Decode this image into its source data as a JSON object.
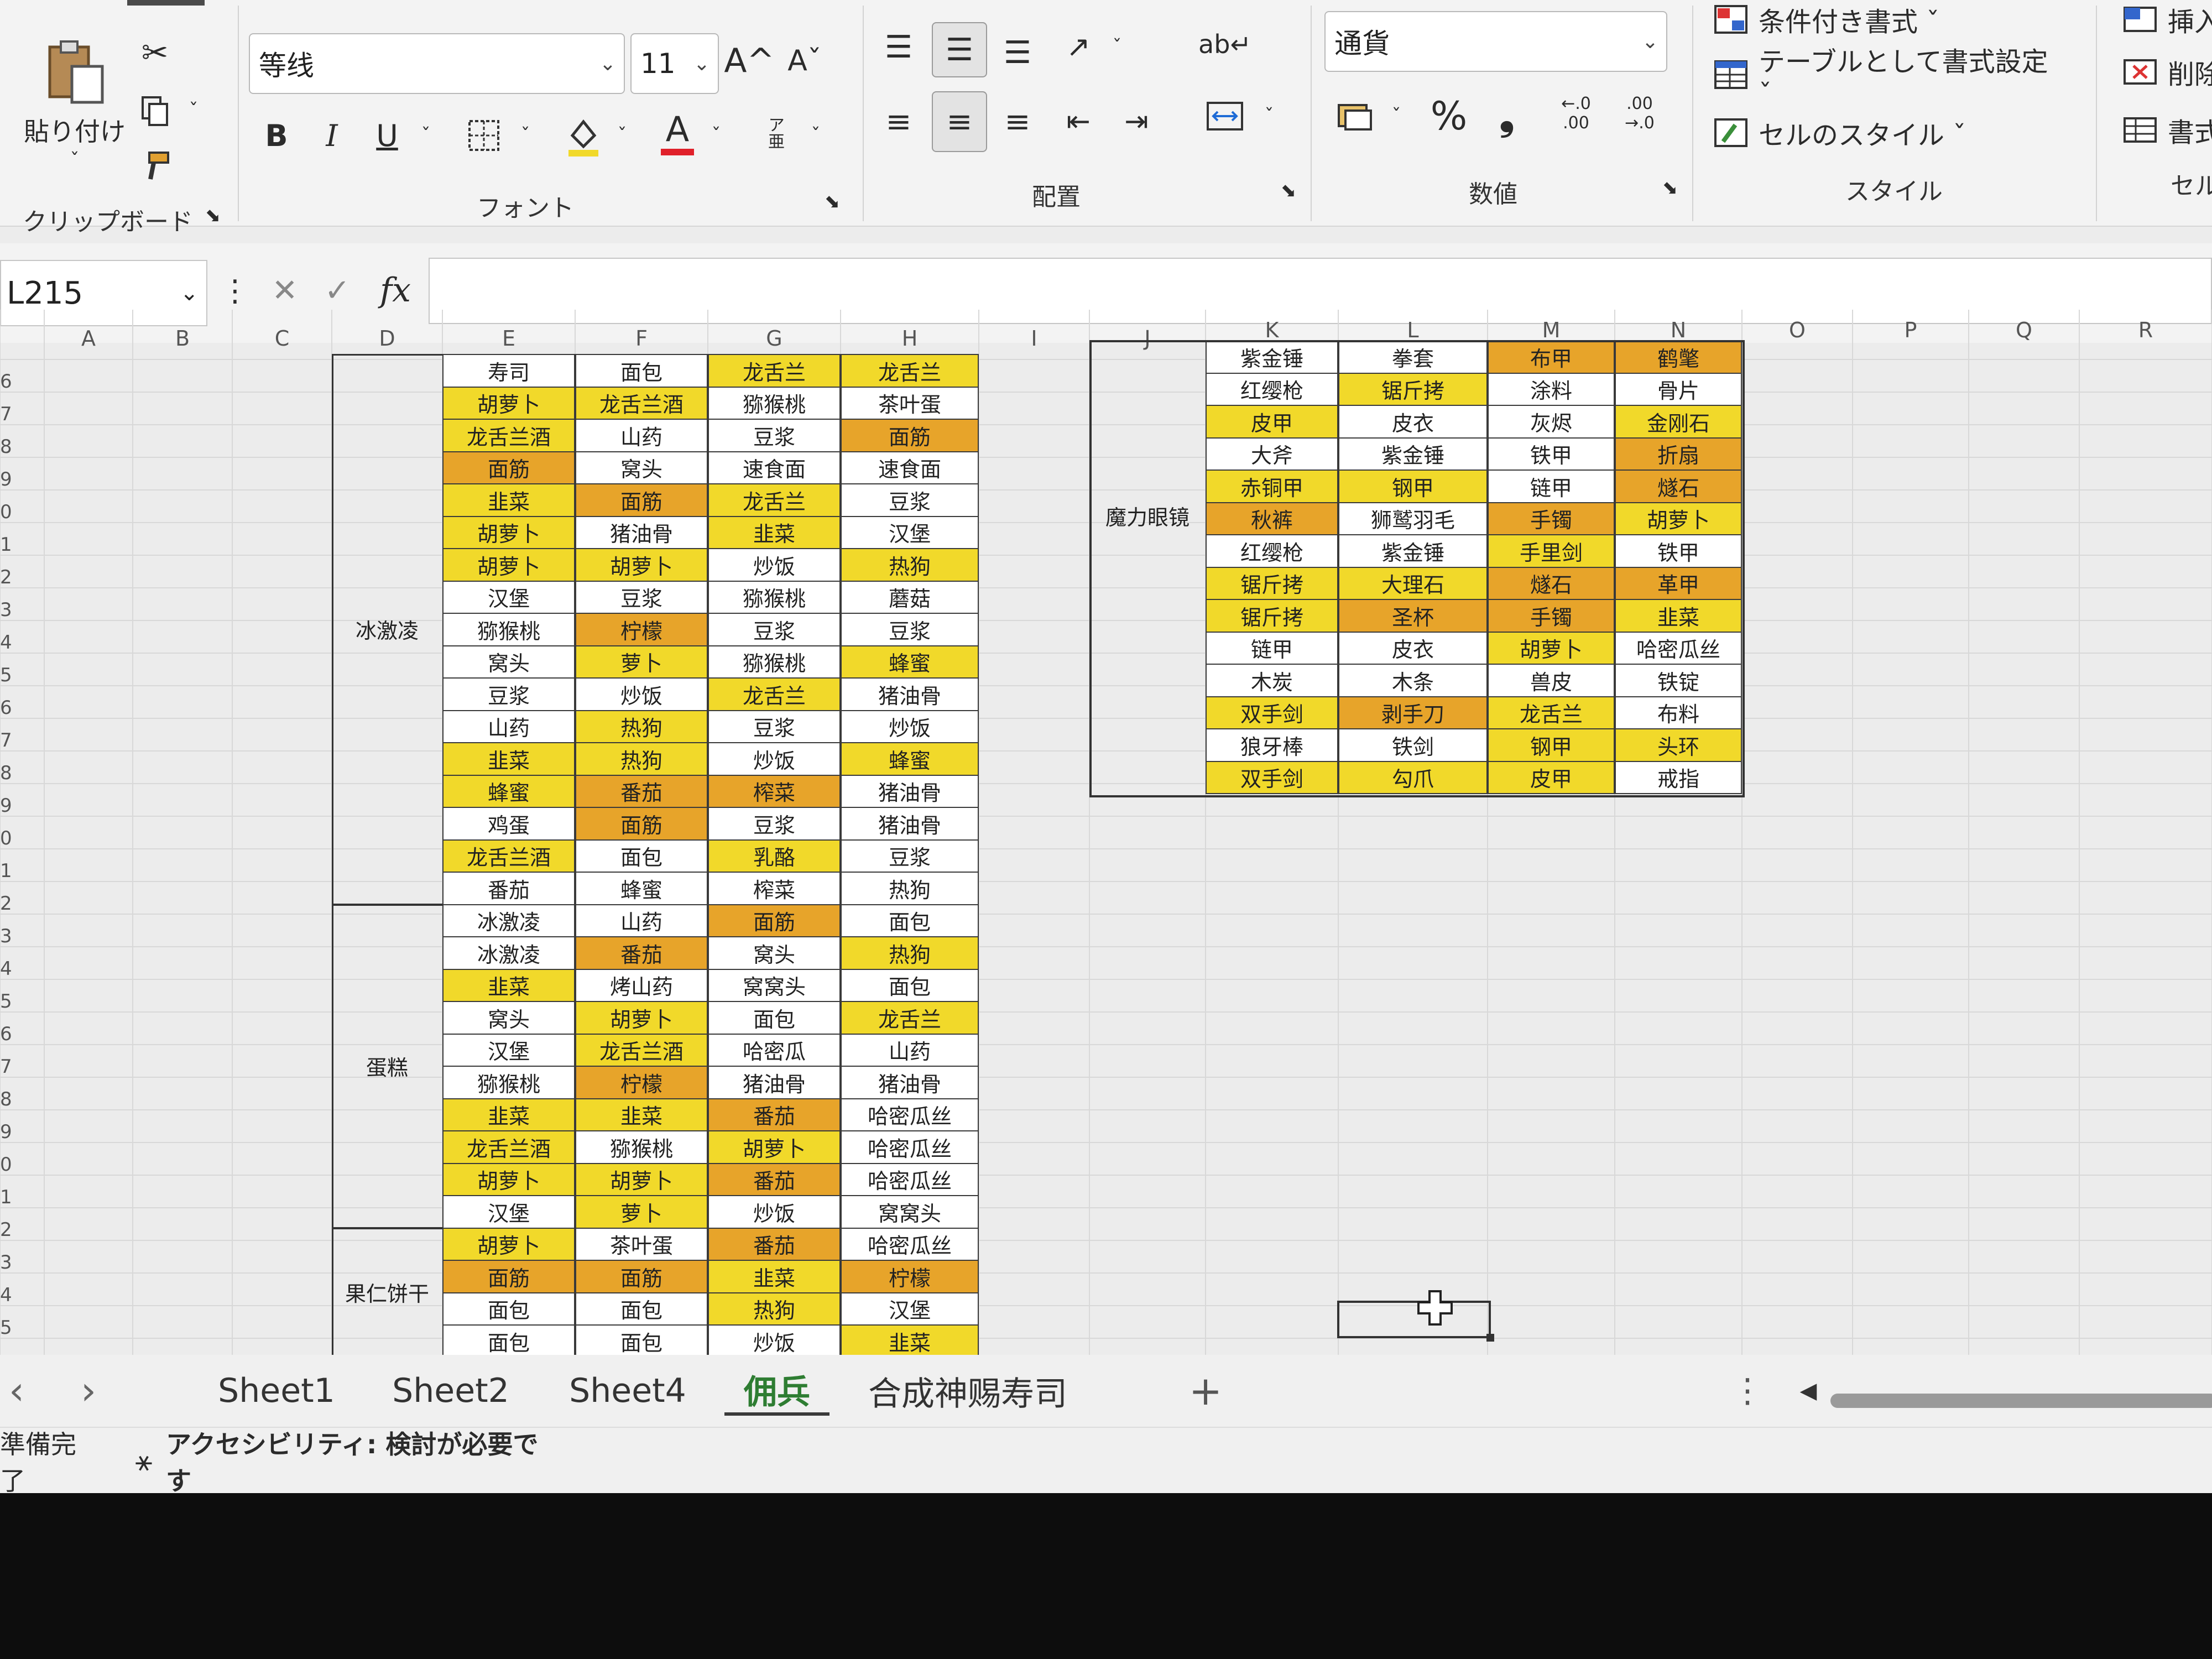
{
  "ribbon": {
    "clipboard": {
      "paste_label": "貼り付け",
      "group_label": "クリップボード"
    },
    "font": {
      "font_name": "等线",
      "font_size": "11",
      "group_label": "フォント",
      "bold": "B",
      "italic": "I",
      "underline": "U",
      "grow": "A^",
      "shrink": "Aˇ",
      "color_a": "A",
      "phonetic": "ア亜"
    },
    "alignment": {
      "group_label": "配置"
    },
    "number": {
      "format": "通貨",
      "percent": "%",
      "comma": "❟",
      "group_label": "数値",
      "inc_dec": "←.0 .00",
      "dec_dec": ".00 →.0"
    },
    "styles": {
      "conditional": "条件付き書式 ˇ",
      "table": "テーブルとして書式設定 ˇ",
      "cell_styles": "セルのスタイル ˇ",
      "group_label": "スタイル"
    },
    "cells": {
      "insert": "挿入",
      "delete": "削除",
      "format": "書式",
      "group_label": "セル"
    }
  },
  "formula_bar": {
    "name_box": "L215",
    "fx": "fx",
    "cancel": "✕",
    "enter": "✓"
  },
  "columns": [
    "A",
    "B",
    "C",
    "D",
    "E",
    "F",
    "G",
    "H",
    "I",
    "J",
    "K",
    "L",
    "M",
    "N",
    "O",
    "P",
    "Q",
    "R"
  ],
  "row_numbers": [
    "6",
    "7",
    "8",
    "9",
    "0",
    "1",
    "2",
    "3",
    "4",
    "5",
    "6",
    "7",
    "8",
    "9",
    "0",
    "1",
    "2",
    "3",
    "4",
    "5",
    "6",
    "7",
    "8",
    "9",
    "0",
    "1",
    "2",
    "3",
    "4",
    "5"
  ],
  "colors": {
    "yellow": "#f1d92a",
    "orange": "#e7a42a",
    "white": "#ffffff",
    "grid": "#d8d8d8"
  },
  "left_groups": [
    {
      "label": "冰激凌"
    },
    {
      "label": "蛋糕"
    },
    {
      "label": "果仁饼干"
    }
  ],
  "left_table": [
    [
      [
        "寿司",
        "w"
      ],
      [
        "面包",
        "w"
      ],
      [
        "龙舌兰",
        "y"
      ],
      [
        "龙舌兰",
        "y"
      ]
    ],
    [
      [
        "胡萝卜",
        "y"
      ],
      [
        "龙舌兰酒",
        "y"
      ],
      [
        "猕猴桃",
        "w"
      ],
      [
        "茶叶蛋",
        "w"
      ]
    ],
    [
      [
        "龙舌兰酒",
        "y"
      ],
      [
        "山药",
        "w"
      ],
      [
        "豆浆",
        "w"
      ],
      [
        "面筋",
        "o"
      ]
    ],
    [
      [
        "面筋",
        "o"
      ],
      [
        "窝头",
        "w"
      ],
      [
        "速食面",
        "w"
      ],
      [
        "速食面",
        "w"
      ]
    ],
    [
      [
        "韭菜",
        "y"
      ],
      [
        "面筋",
        "o"
      ],
      [
        "龙舌兰",
        "y"
      ],
      [
        "豆浆",
        "w"
      ]
    ],
    [
      [
        "胡萝卜",
        "y"
      ],
      [
        "猪油骨",
        "w"
      ],
      [
        "韭菜",
        "y"
      ],
      [
        "汉堡",
        "w"
      ]
    ],
    [
      [
        "胡萝卜",
        "y"
      ],
      [
        "胡萝卜",
        "y"
      ],
      [
        "炒饭",
        "w"
      ],
      [
        "热狗",
        "y"
      ]
    ],
    [
      [
        "汉堡",
        "w"
      ],
      [
        "豆浆",
        "w"
      ],
      [
        "猕猴桃",
        "w"
      ],
      [
        "蘑菇",
        "w"
      ]
    ],
    [
      [
        "猕猴桃",
        "w"
      ],
      [
        "柠檬",
        "o"
      ],
      [
        "豆浆",
        "w"
      ],
      [
        "豆浆",
        "w"
      ]
    ],
    [
      [
        "窝头",
        "w"
      ],
      [
        "萝卜",
        "y"
      ],
      [
        "猕猴桃",
        "w"
      ],
      [
        "蜂蜜",
        "y"
      ]
    ],
    [
      [
        "豆浆",
        "w"
      ],
      [
        "炒饭",
        "w"
      ],
      [
        "龙舌兰",
        "y"
      ],
      [
        "猪油骨",
        "w"
      ]
    ],
    [
      [
        "山药",
        "w"
      ],
      [
        "热狗",
        "y"
      ],
      [
        "豆浆",
        "w"
      ],
      [
        "炒饭",
        "w"
      ]
    ],
    [
      [
        "韭菜",
        "y"
      ],
      [
        "热狗",
        "y"
      ],
      [
        "炒饭",
        "w"
      ],
      [
        "蜂蜜",
        "y"
      ]
    ],
    [
      [
        "蜂蜜",
        "y"
      ],
      [
        "番茄",
        "o"
      ],
      [
        "榨菜",
        "o"
      ],
      [
        "猪油骨",
        "w"
      ]
    ],
    [
      [
        "鸡蛋",
        "w"
      ],
      [
        "面筋",
        "o"
      ],
      [
        "豆浆",
        "w"
      ],
      [
        "猪油骨",
        "w"
      ]
    ],
    [
      [
        "龙舌兰酒",
        "y"
      ],
      [
        "面包",
        "w"
      ],
      [
        "乳酪",
        "y"
      ],
      [
        "豆浆",
        "w"
      ]
    ],
    [
      [
        "番茄",
        "w"
      ],
      [
        "蜂蜜",
        "w"
      ],
      [
        "榨菜",
        "w"
      ],
      [
        "热狗",
        "w"
      ]
    ],
    [
      [
        "冰激凌",
        "w"
      ],
      [
        "山药",
        "w"
      ],
      [
        "面筋",
        "o"
      ],
      [
        "面包",
        "w"
      ]
    ],
    [
      [
        "冰激凌",
        "w"
      ],
      [
        "番茄",
        "o"
      ],
      [
        "窝头",
        "w"
      ],
      [
        "热狗",
        "y"
      ]
    ],
    [
      [
        "韭菜",
        "y"
      ],
      [
        "烤山药",
        "w"
      ],
      [
        "窝窝头",
        "w"
      ],
      [
        "面包",
        "w"
      ]
    ],
    [
      [
        "窝头",
        "w"
      ],
      [
        "胡萝卜",
        "y"
      ],
      [
        "面包",
        "w"
      ],
      [
        "龙舌兰",
        "y"
      ]
    ],
    [
      [
        "汉堡",
        "w"
      ],
      [
        "龙舌兰酒",
        "y"
      ],
      [
        "哈密瓜",
        "w"
      ],
      [
        "山药",
        "w"
      ]
    ],
    [
      [
        "猕猴桃",
        "w"
      ],
      [
        "柠檬",
        "o"
      ],
      [
        "猪油骨",
        "w"
      ],
      [
        "猪油骨",
        "w"
      ]
    ],
    [
      [
        "韭菜",
        "y"
      ],
      [
        "韭菜",
        "y"
      ],
      [
        "番茄",
        "o"
      ],
      [
        "哈密瓜丝",
        "w"
      ]
    ],
    [
      [
        "龙舌兰酒",
        "y"
      ],
      [
        "猕猴桃",
        "w"
      ],
      [
        "胡萝卜",
        "y"
      ],
      [
        "哈密瓜丝",
        "w"
      ]
    ],
    [
      [
        "胡萝卜",
        "y"
      ],
      [
        "胡萝卜",
        "y"
      ],
      [
        "番茄",
        "o"
      ],
      [
        "哈密瓜丝",
        "w"
      ]
    ],
    [
      [
        "汉堡",
        "w"
      ],
      [
        "萝卜",
        "y"
      ],
      [
        "炒饭",
        "w"
      ],
      [
        "窝窝头",
        "w"
      ]
    ],
    [
      [
        "胡萝卜",
        "y"
      ],
      [
        "茶叶蛋",
        "w"
      ],
      [
        "番茄",
        "o"
      ],
      [
        "哈密瓜丝",
        "w"
      ]
    ],
    [
      [
        "面筋",
        "o"
      ],
      [
        "面筋",
        "o"
      ],
      [
        "韭菜",
        "y"
      ],
      [
        "柠檬",
        "o"
      ]
    ],
    [
      [
        "面包",
        "w"
      ],
      [
        "面包",
        "w"
      ],
      [
        "热狗",
        "y"
      ],
      [
        "汉堡",
        "w"
      ]
    ],
    [
      [
        "面包",
        "w"
      ],
      [
        "面包",
        "w"
      ],
      [
        "炒饭",
        "w"
      ],
      [
        "韭菜",
        "y"
      ]
    ]
  ],
  "right_group": {
    "label": "魔力眼镜"
  },
  "right_table": [
    [
      [
        "紫金锤",
        "w"
      ],
      [
        "拳套",
        "w"
      ],
      [
        "布甲",
        "o"
      ],
      [
        "鹤氅",
        "o"
      ]
    ],
    [
      [
        "红缨枪",
        "w"
      ],
      [
        "锯斤拷",
        "y"
      ],
      [
        "涂料",
        "w"
      ],
      [
        "骨片",
        "w"
      ]
    ],
    [
      [
        "皮甲",
        "y"
      ],
      [
        "皮衣",
        "w"
      ],
      [
        "灰烬",
        "w"
      ],
      [
        "金刚石",
        "y"
      ]
    ],
    [
      [
        "大斧",
        "w"
      ],
      [
        "紫金锤",
        "w"
      ],
      [
        "铁甲",
        "w"
      ],
      [
        "折扇",
        "o"
      ]
    ],
    [
      [
        "赤铜甲",
        "y"
      ],
      [
        "钢甲",
        "y"
      ],
      [
        "链甲",
        "w"
      ],
      [
        "燧石",
        "o"
      ]
    ],
    [
      [
        "秋裤",
        "o"
      ],
      [
        "狮鹫羽毛",
        "w"
      ],
      [
        "手镯",
        "o"
      ],
      [
        "胡萝卜",
        "y"
      ]
    ],
    [
      [
        "红缨枪",
        "w"
      ],
      [
        "紫金锤",
        "w"
      ],
      [
        "手里剑",
        "y"
      ],
      [
        "铁甲",
        "w"
      ]
    ],
    [
      [
        "锯斤拷",
        "y"
      ],
      [
        "大理石",
        "y"
      ],
      [
        "燧石",
        "o"
      ],
      [
        "革甲",
        "o"
      ]
    ],
    [
      [
        "锯斤拷",
        "y"
      ],
      [
        "圣杯",
        "o"
      ],
      [
        "手镯",
        "o"
      ],
      [
        "韭菜",
        "y"
      ]
    ],
    [
      [
        "链甲",
        "w"
      ],
      [
        "皮衣",
        "w"
      ],
      [
        "胡萝卜",
        "y"
      ],
      [
        "哈密瓜丝",
        "w"
      ]
    ],
    [
      [
        "木炭",
        "w"
      ],
      [
        "木条",
        "w"
      ],
      [
        "兽皮",
        "w"
      ],
      [
        "铁锭",
        "w"
      ]
    ],
    [
      [
        "双手剑",
        "y"
      ],
      [
        "剥手刀",
        "o"
      ],
      [
        "龙舌兰",
        "y"
      ],
      [
        "布料",
        "w"
      ]
    ],
    [
      [
        "狼牙棒",
        "w"
      ],
      [
        "铁剑",
        "w"
      ],
      [
        "钢甲",
        "y"
      ],
      [
        "头环",
        "y"
      ]
    ],
    [
      [
        "双手剑",
        "y"
      ],
      [
        "勾爪",
        "y"
      ],
      [
        "皮甲",
        "y"
      ],
      [
        "戒指",
        "w"
      ]
    ]
  ],
  "sheets": [
    "Sheet1",
    "Sheet2",
    "Sheet4",
    "佣兵",
    "合成神赐寿司"
  ],
  "tabbar": {
    "prev": "‹",
    "next": "›",
    "add": "+",
    "more": "⋮",
    "scroll_left": "◀"
  },
  "status": {
    "ready": "準備完了",
    "accessibility": "アクセシビリティ: 検討が必要です"
  }
}
